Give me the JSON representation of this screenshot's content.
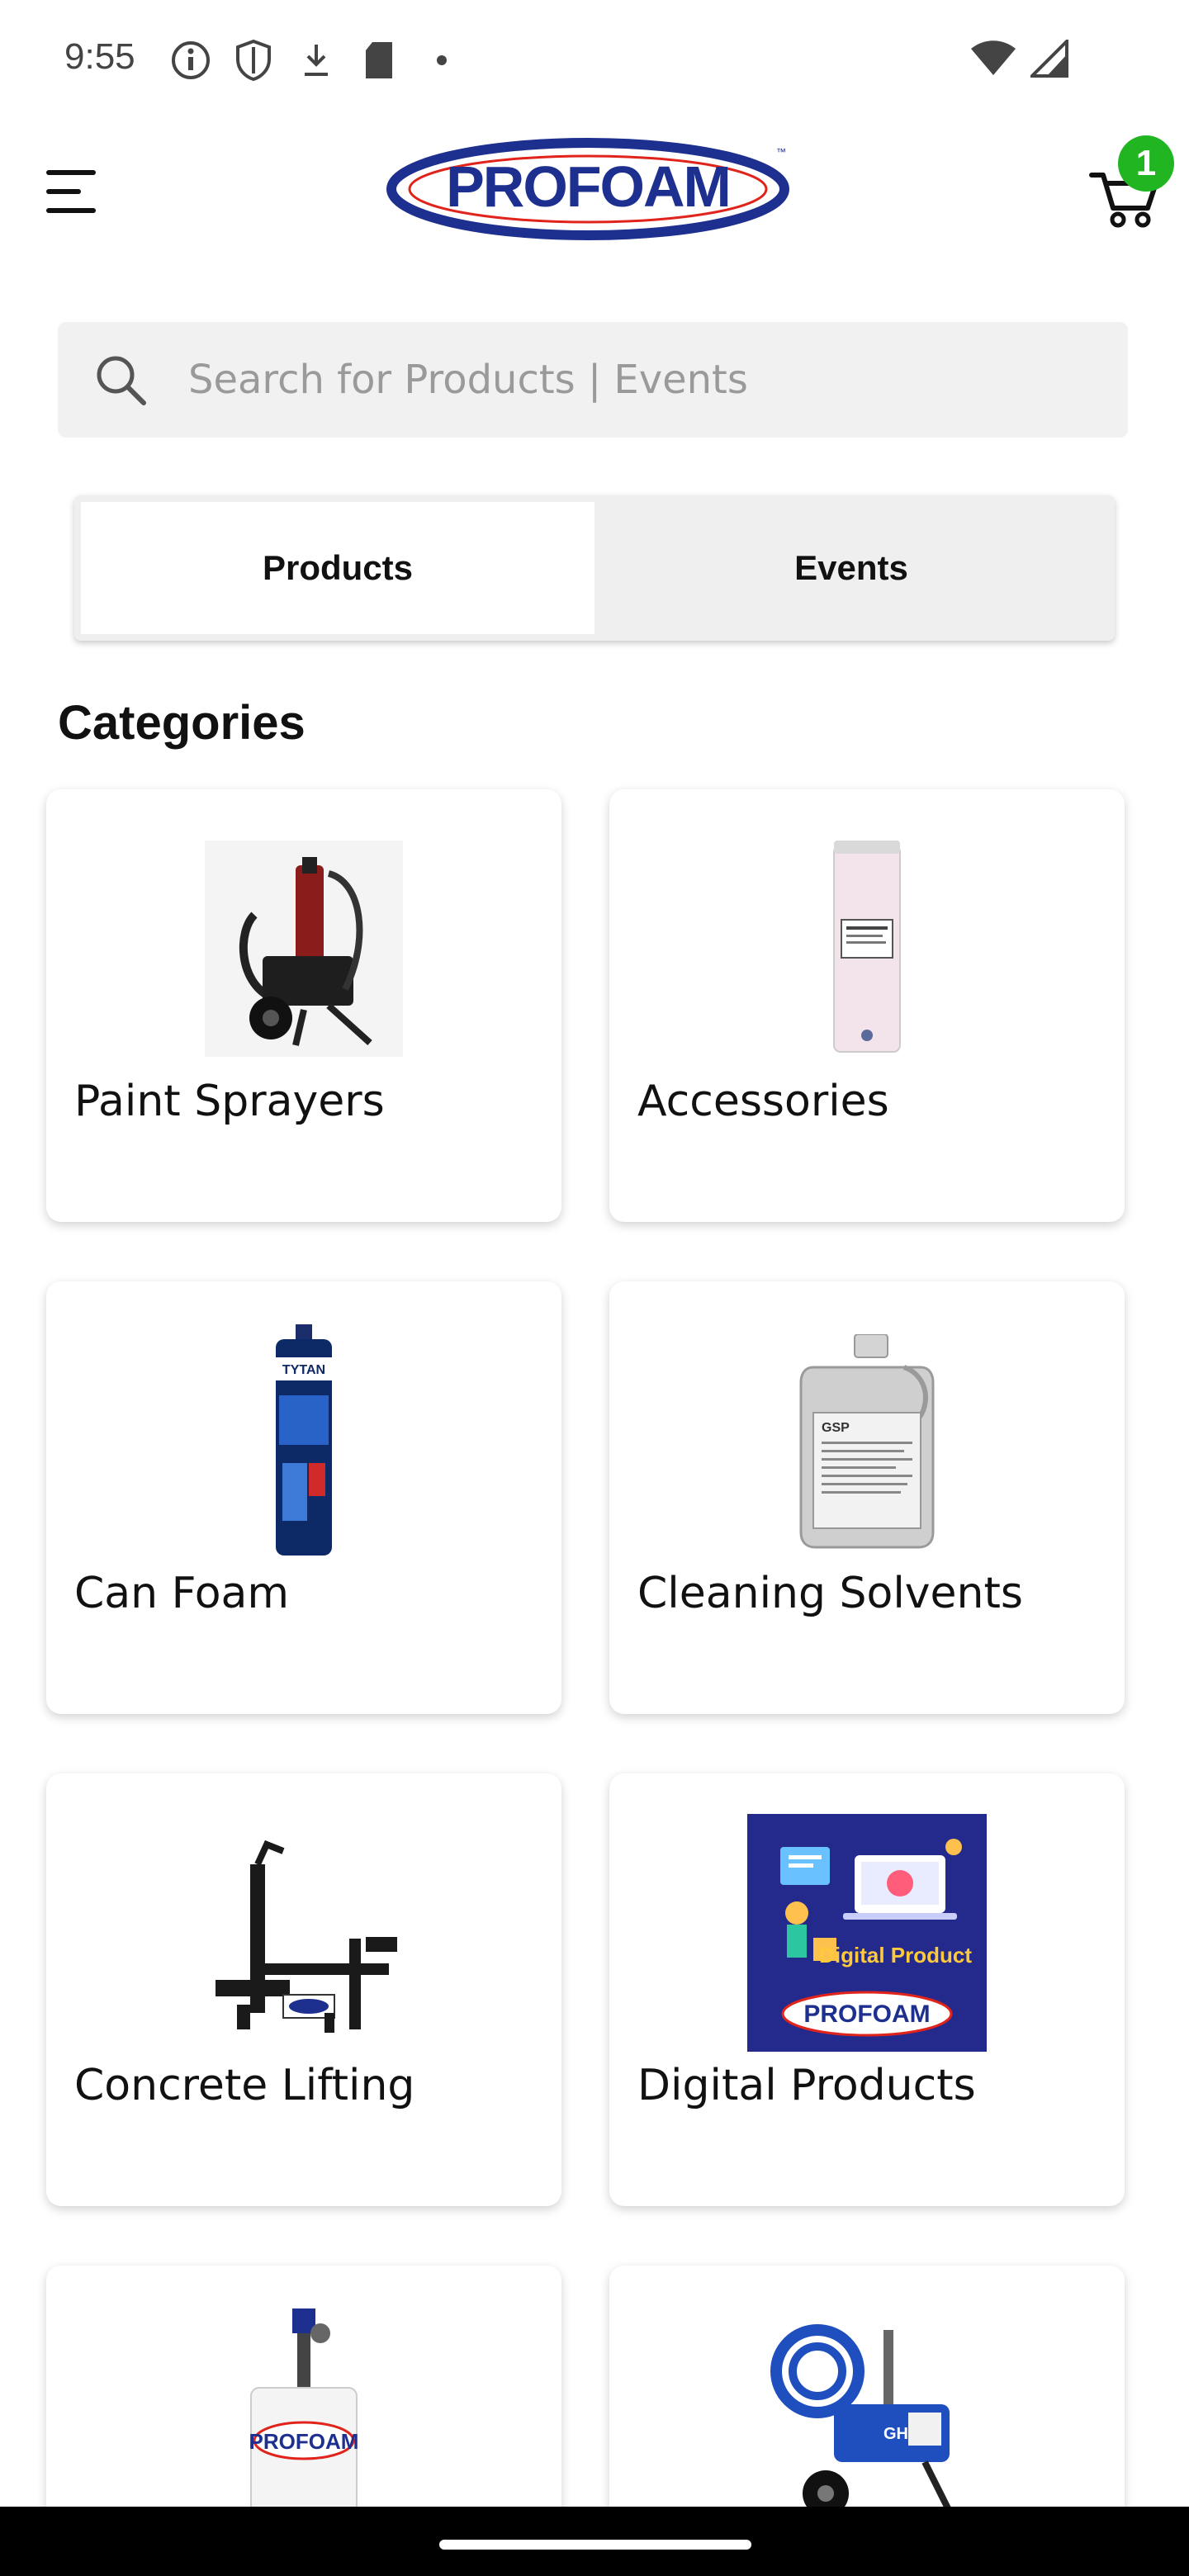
{
  "status_bar": {
    "time": "9:55"
  },
  "header": {
    "logo_text": "PROFOAM",
    "cart_count": "1"
  },
  "search": {
    "placeholder": "Search for Products | Events"
  },
  "tabs": [
    {
      "label": "Products",
      "active": true
    },
    {
      "label": "Events",
      "active": false
    }
  ],
  "categories": {
    "title": "Categories",
    "items": [
      {
        "label": "Paint Sprayers",
        "icon": "paint-sprayer-image"
      },
      {
        "label": "Accessories",
        "icon": "filter-cartridge-image"
      },
      {
        "label": "Can Foam",
        "icon": "foam-can-image"
      },
      {
        "label": "Cleaning Solvents",
        "icon": "solvent-jug-image"
      },
      {
        "label": "Concrete Lifting",
        "icon": "concrete-lifter-image"
      },
      {
        "label": "Digital Products",
        "icon": "digital-product-image"
      },
      {
        "label": "",
        "icon": "foam-machine-image"
      },
      {
        "label": "",
        "icon": "graco-sprayer-image"
      }
    ],
    "digital_product_art_text": "Digital Product"
  },
  "colors": {
    "brand_blue": "#1d2f8f",
    "brand_red": "#e0241b",
    "badge_green": "#22b522",
    "search_bg": "#f1f1f1"
  }
}
